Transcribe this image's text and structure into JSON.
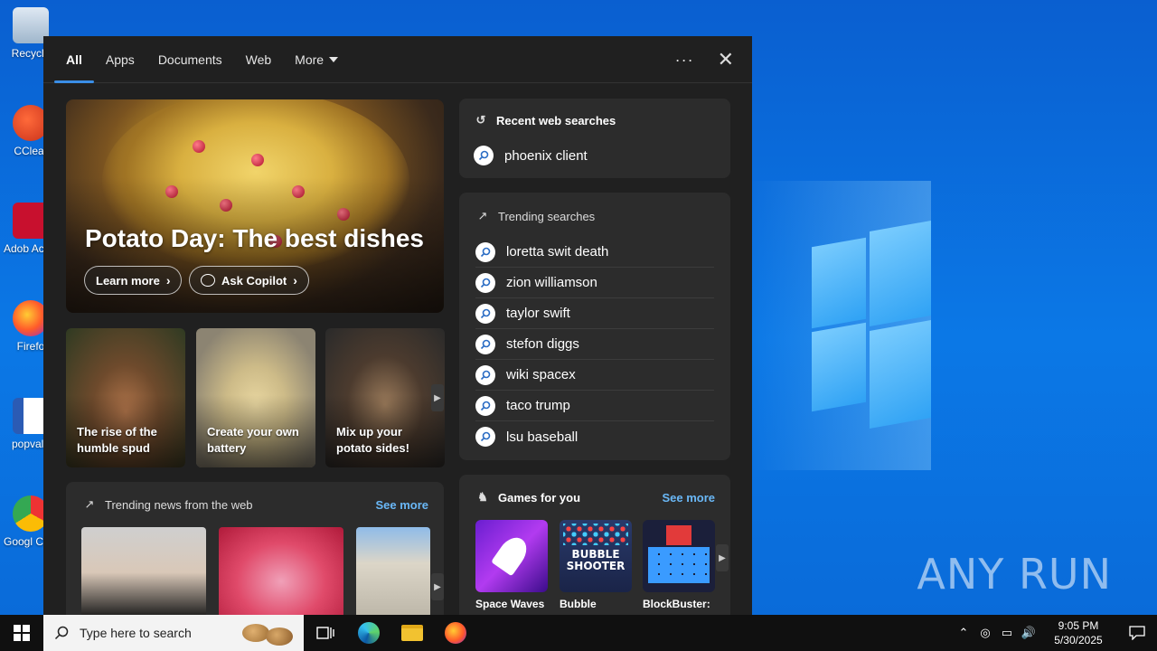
{
  "desktop": {
    "icons": [
      {
        "label": "Recycle",
        "icon": "recycle-bin-icon"
      },
      {
        "label": "CClear",
        "icon": "ccleaner-icon"
      },
      {
        "label": "Adob Acrob",
        "icon": "adobe-acrobat-icon"
      },
      {
        "label": "Firefo",
        "icon": "firefox-icon"
      },
      {
        "label": "popvalu",
        "icon": "word-document-icon"
      },
      {
        "label": "Googl Chron",
        "icon": "chrome-icon"
      }
    ],
    "watermark": "ANY RUN"
  },
  "search_panel": {
    "tabs": [
      {
        "label": "All",
        "active": true
      },
      {
        "label": "Apps"
      },
      {
        "label": "Documents"
      },
      {
        "label": "Web"
      },
      {
        "label": "More"
      }
    ],
    "hero": {
      "title": "Potato Day: The best dishes",
      "learn_more": "Learn more",
      "ask_copilot": "Ask Copilot"
    },
    "cards": [
      {
        "caption": "The rise of the humble spud"
      },
      {
        "caption": "Create your own battery"
      },
      {
        "caption": "Mix up your potato sides!"
      }
    ],
    "recent": {
      "heading": "Recent web searches",
      "items": [
        "phoenix client"
      ]
    },
    "trending": {
      "heading": "Trending searches",
      "items": [
        "loretta swit death",
        "zion williamson",
        "taylor swift",
        "stefon diggs",
        "wiki spacex",
        "taco trump",
        "lsu baseball"
      ]
    },
    "news": {
      "heading": "Trending news from the web",
      "see_more": "See more"
    },
    "games": {
      "heading": "Games for you",
      "see_more": "See more",
      "items": [
        "Space Waves",
        "Bubble",
        "BlockBuster:"
      ]
    }
  },
  "taskbar": {
    "search_placeholder": "Type here to search",
    "time": "9:05 PM",
    "date": "5/30/2025"
  },
  "colors": {
    "accent": "#3a8ee6",
    "link": "#6ab8f7",
    "panel": "#202020",
    "box": "#2c2c2c"
  }
}
